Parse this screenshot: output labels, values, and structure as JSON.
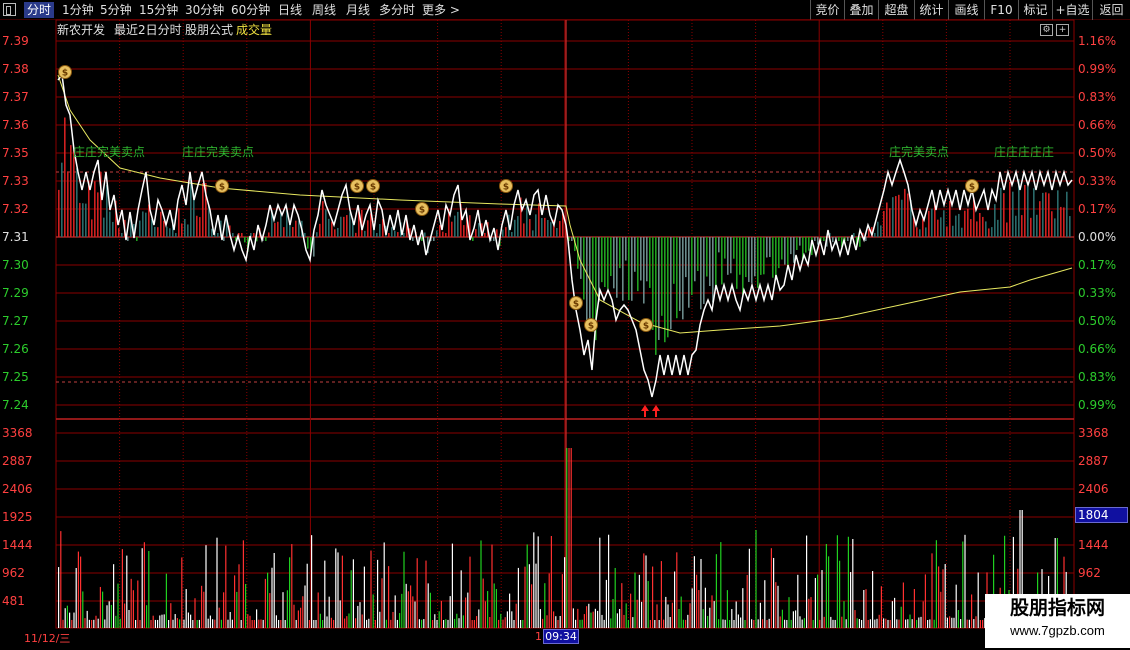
{
  "toolbar": {
    "periods": [
      "分时",
      "1分钟",
      "5分钟",
      "15分钟",
      "30分钟",
      "60分钟",
      "日线",
      "周线",
      "月线",
      "多分时",
      "更多 >"
    ],
    "active_index": 0,
    "right_buttons": [
      "竞价",
      "叠加",
      "超盘",
      "统计",
      "画线",
      "F10",
      "标记",
      "+自选",
      "返回"
    ]
  },
  "infobar": {
    "stock_name": "新农开发",
    "period_label": "最近2日分时",
    "formula_label": "股朋公式",
    "indicator_label": "成交量"
  },
  "price_axis": {
    "left_labels": [
      "7.39",
      "7.38",
      "7.37",
      "7.36",
      "7.35",
      "7.33",
      "7.32",
      "7.31",
      "7.30",
      "7.29",
      "7.27",
      "7.26",
      "7.25",
      "7.24"
    ],
    "left_colors": [
      "red",
      "red",
      "red",
      "red",
      "red",
      "red",
      "red",
      "neutral",
      "green",
      "green",
      "green",
      "green",
      "green",
      "green"
    ],
    "right_labels": [
      "1.16%",
      "0.99%",
      "0.83%",
      "0.66%",
      "0.50%",
      "0.33%",
      "0.17%",
      "0.00%",
      "0.17%",
      "0.33%",
      "0.50%",
      "0.66%",
      "0.83%",
      "0.99%"
    ]
  },
  "volume_axis": {
    "labels": [
      "3368",
      "2887",
      "2406",
      "1925",
      "1444",
      "962",
      "481"
    ],
    "current_value": "1804"
  },
  "markers": {
    "sell_point_text": "完美卖点",
    "sell_point_short": "庄",
    "money_icon": "money-bag-icon",
    "buy_arrow_icon": "up-arrow-icon"
  },
  "time": {
    "date_label": "11/12/三",
    "cursor_time": "09:34",
    "cursor_prefix": "1"
  },
  "watermark": {
    "title": "股朋指标网",
    "url": "www.7gpzb.com"
  },
  "colors": {
    "background": "#000000",
    "grid": "#8a0000",
    "price_line": "#ffffff",
    "avg_line": "#e8e860",
    "up": "#ff3030",
    "down": "#20c020",
    "sell_label": "#40e040"
  }
}
